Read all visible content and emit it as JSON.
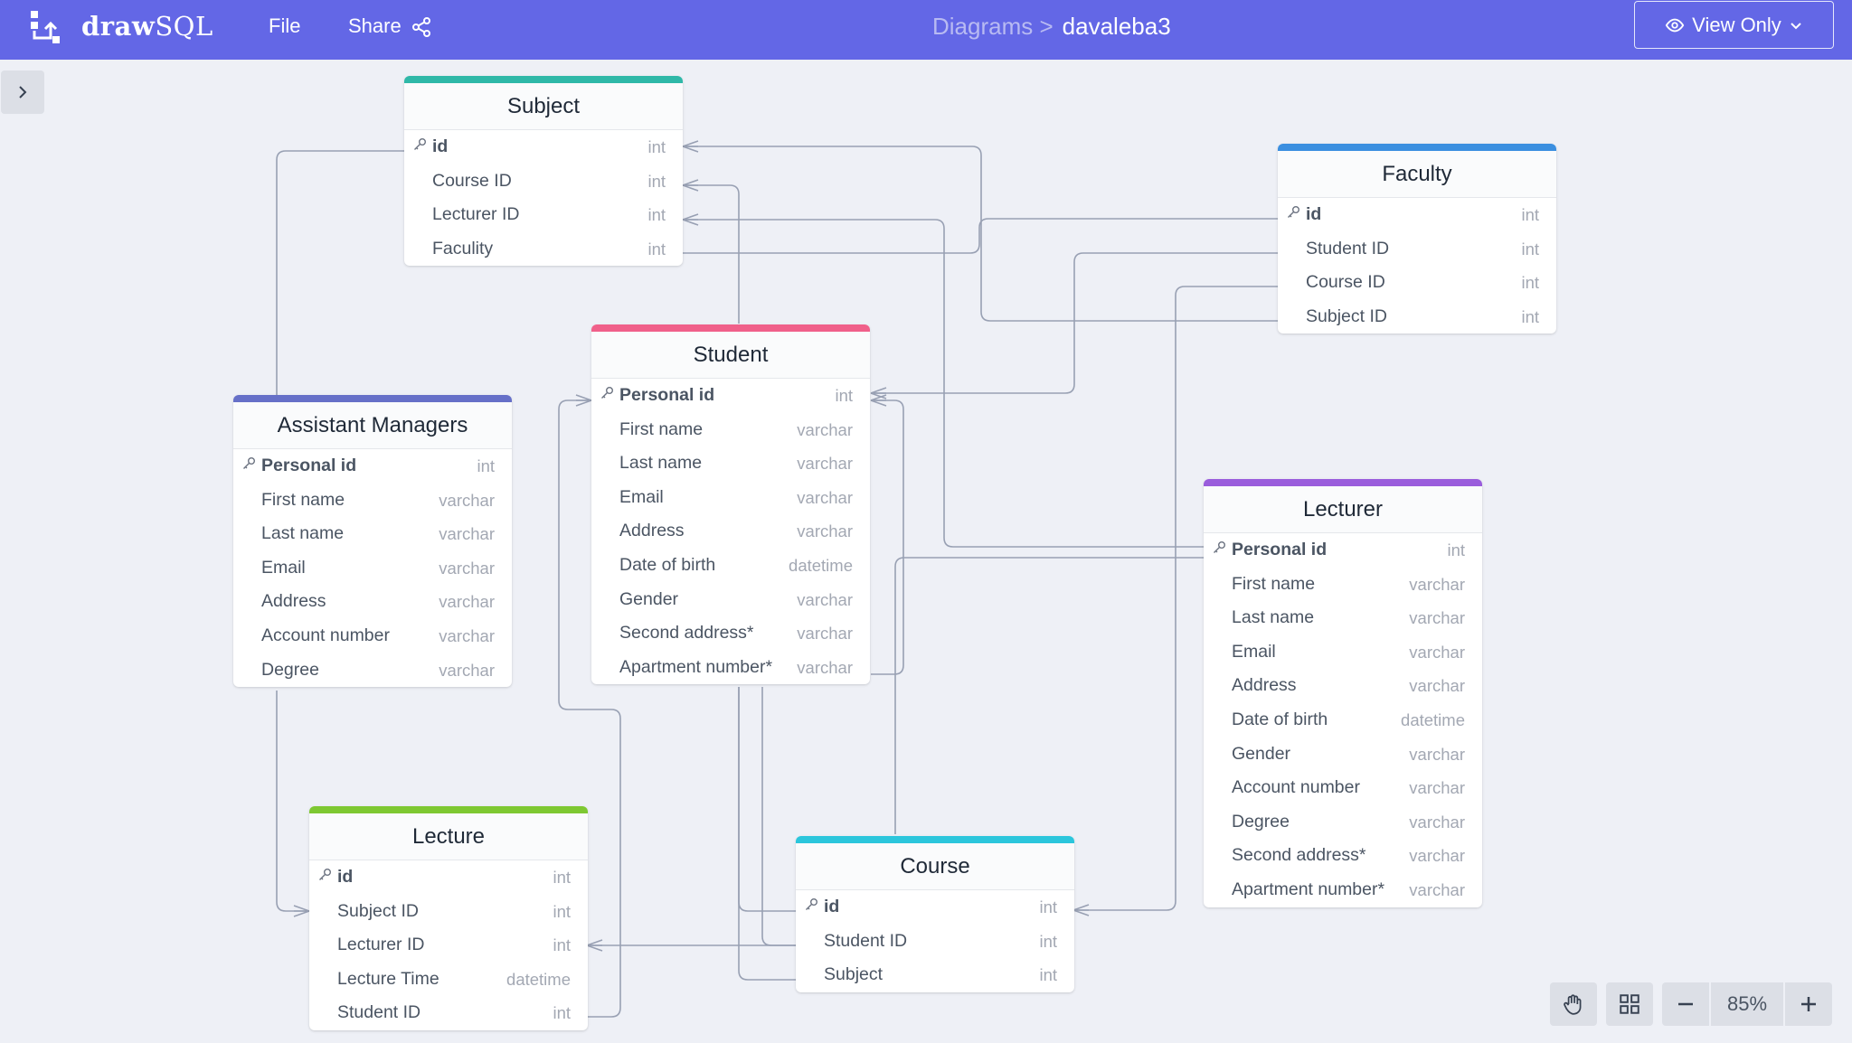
{
  "app": {
    "brand_bold": "draw",
    "brand_light": "SQL",
    "menu_file": "File",
    "menu_share": "Share",
    "breadcrumb_parent": "Diagrams >",
    "diagram_name": "davaleba3",
    "view_mode": "View Only",
    "accent_color": "#6367e6"
  },
  "zoom": {
    "level": "85%"
  },
  "tables": {
    "subject": {
      "name": "Subject",
      "color": "#2fb8a8",
      "fields": [
        {
          "name": "id",
          "type": "int",
          "pk": true
        },
        {
          "name": "Course ID",
          "type": "int"
        },
        {
          "name": "Lecturer ID",
          "type": "int"
        },
        {
          "name": "Faculity",
          "type": "int"
        }
      ]
    },
    "faculty": {
      "name": "Faculty",
      "color": "#3b8fe0",
      "fields": [
        {
          "name": "id",
          "type": "int",
          "pk": true
        },
        {
          "name": "Student ID",
          "type": "int"
        },
        {
          "name": "Course ID",
          "type": "int"
        },
        {
          "name": "Subject ID",
          "type": "int"
        }
      ]
    },
    "student": {
      "name": "Student",
      "color": "#f0608a",
      "fields": [
        {
          "name": "Personal id",
          "type": "int",
          "pk": true
        },
        {
          "name": "First name",
          "type": "varchar"
        },
        {
          "name": "Last name",
          "type": "varchar"
        },
        {
          "name": "Email",
          "type": "varchar"
        },
        {
          "name": "Address",
          "type": "varchar"
        },
        {
          "name": "Date of birth",
          "type": "datetime"
        },
        {
          "name": "Gender",
          "type": "varchar"
        },
        {
          "name": "Second address*",
          "type": "varchar"
        },
        {
          "name": "Apartment number*",
          "type": "varchar"
        }
      ]
    },
    "assistant_managers": {
      "name": "Assistant Managers",
      "color": "#6670c8",
      "fields": [
        {
          "name": "Personal id",
          "type": "int",
          "pk": true
        },
        {
          "name": "First name",
          "type": "varchar"
        },
        {
          "name": "Last name",
          "type": "varchar"
        },
        {
          "name": "Email",
          "type": "varchar"
        },
        {
          "name": "Address",
          "type": "varchar"
        },
        {
          "name": "Account number",
          "type": "varchar"
        },
        {
          "name": "Degree",
          "type": "varchar"
        }
      ]
    },
    "lecturer": {
      "name": "Lecturer",
      "color": "#9a5ddc",
      "fields": [
        {
          "name": "Personal id",
          "type": "int",
          "pk": true
        },
        {
          "name": "First name",
          "type": "varchar"
        },
        {
          "name": "Last name",
          "type": "varchar"
        },
        {
          "name": "Email",
          "type": "varchar"
        },
        {
          "name": "Address",
          "type": "varchar"
        },
        {
          "name": "Date of birth",
          "type": "datetime"
        },
        {
          "name": "Gender",
          "type": "varchar"
        },
        {
          "name": "Account number",
          "type": "varchar"
        },
        {
          "name": "Degree",
          "type": "varchar"
        },
        {
          "name": "Second address*",
          "type": "varchar"
        },
        {
          "name": "Apartment number*",
          "type": "varchar"
        }
      ]
    },
    "lecture": {
      "name": "Lecture",
      "color": "#7ec832",
      "fields": [
        {
          "name": "id",
          "type": "int",
          "pk": true
        },
        {
          "name": "Subject ID",
          "type": "int"
        },
        {
          "name": "Lecturer ID",
          "type": "int"
        },
        {
          "name": "Lecture Time",
          "type": "datetime"
        },
        {
          "name": "Student ID",
          "type": "int"
        }
      ]
    },
    "course": {
      "name": "Course",
      "color": "#2bc6dc",
      "fields": [
        {
          "name": "id",
          "type": "int",
          "pk": true
        },
        {
          "name": "Student ID",
          "type": "int"
        },
        {
          "name": "Subject",
          "type": "int"
        }
      ]
    }
  }
}
